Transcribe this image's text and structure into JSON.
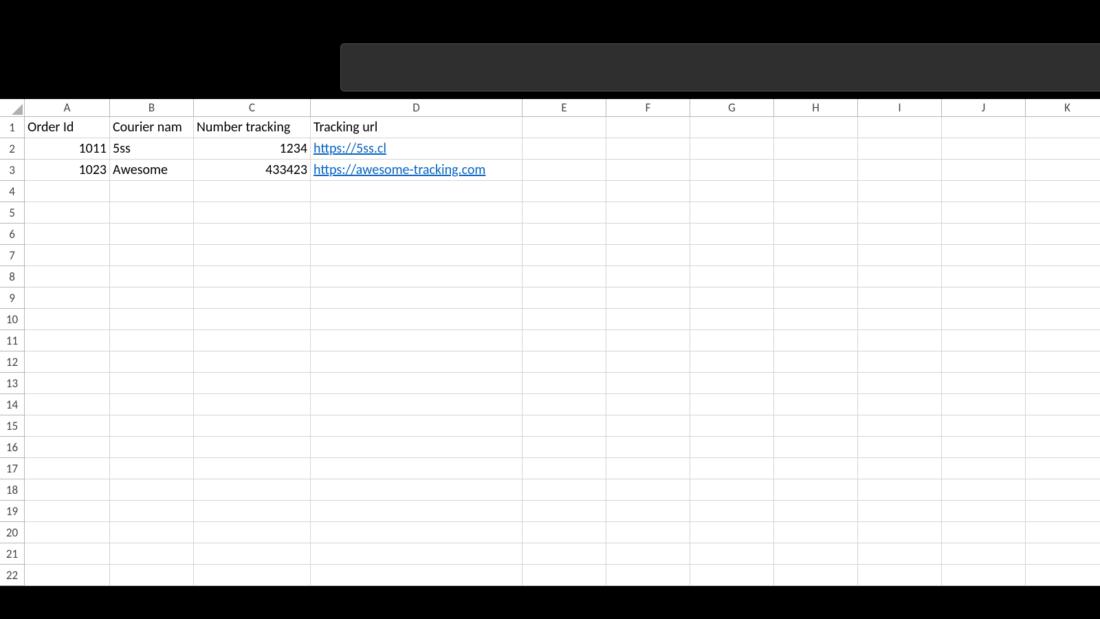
{
  "columns": [
    "A",
    "B",
    "C",
    "D",
    "E",
    "F",
    "G",
    "H",
    "I",
    "J",
    "K"
  ],
  "row_count": 22,
  "headers": {
    "A": "Order Id",
    "B": "Courier nam",
    "C": "Number tracking",
    "D": "Tracking url"
  },
  "rows": [
    {
      "A": "1011",
      "B": "5ss",
      "C": "1234",
      "D": "https://5ss.cl"
    },
    {
      "A": "1023",
      "B": "Awesome",
      "C": "433423",
      "D": "https://awesome-tracking.com"
    }
  ]
}
